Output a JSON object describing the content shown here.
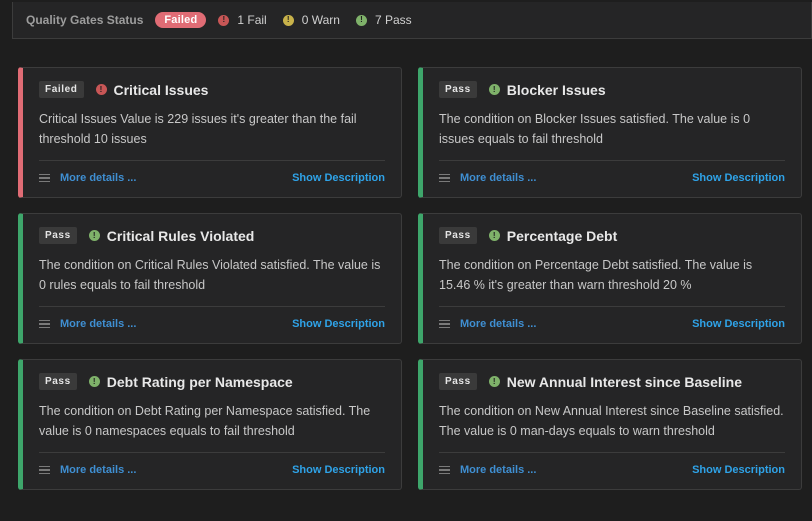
{
  "header": {
    "title": "Quality Gates Status",
    "status": "Failed",
    "fail_count": "1 Fail",
    "warn_count": "0 Warn",
    "pass_count": "7 Pass"
  },
  "icons": {
    "fail": "fail-icon",
    "warn": "warn-icon",
    "pass": "pass-icon",
    "menu": "menu-icon"
  },
  "colors": {
    "fail": "#e06c75",
    "warn": "#c8b24a",
    "pass": "#3ea66b",
    "link": "#2fa3e8"
  },
  "cards": [
    {
      "status": "Failed",
      "title": "Critical Issues",
      "description": "Critical Issues Value is 229 issues it's greater than the fail threshold 10 issues",
      "more_label": "More details ...",
      "show_label": "Show Description"
    },
    {
      "status": "Pass",
      "title": "Blocker Issues",
      "description": "The condition on Blocker Issues satisfied. The value is 0 issues equals to fail threshold",
      "more_label": "More details ...",
      "show_label": "Show Description"
    },
    {
      "status": "Pass",
      "title": "Critical Rules Violated",
      "description": "The condition on Critical Rules Violated satisfied. The value is 0 rules equals to fail threshold",
      "more_label": "More details ...",
      "show_label": "Show Description"
    },
    {
      "status": "Pass",
      "title": "Percentage Debt",
      "description": "The condition on Percentage Debt satisfied. The value is 15.46 % it's greater than warn threshold 20 %",
      "more_label": "More details ...",
      "show_label": "Show Description"
    },
    {
      "status": "Pass",
      "title": "Debt Rating per Namespace",
      "description": "The condition on Debt Rating per Namespace satisfied. The value is 0 namespaces equals to fail threshold",
      "more_label": "More details ...",
      "show_label": "Show Description"
    },
    {
      "status": "Pass",
      "title": "New Annual Interest since Baseline",
      "description": "The condition on New Annual Interest since Baseline satisfied. The value is 0 man-days equals to warn threshold",
      "more_label": "More details ...",
      "show_label": "Show Description"
    }
  ]
}
